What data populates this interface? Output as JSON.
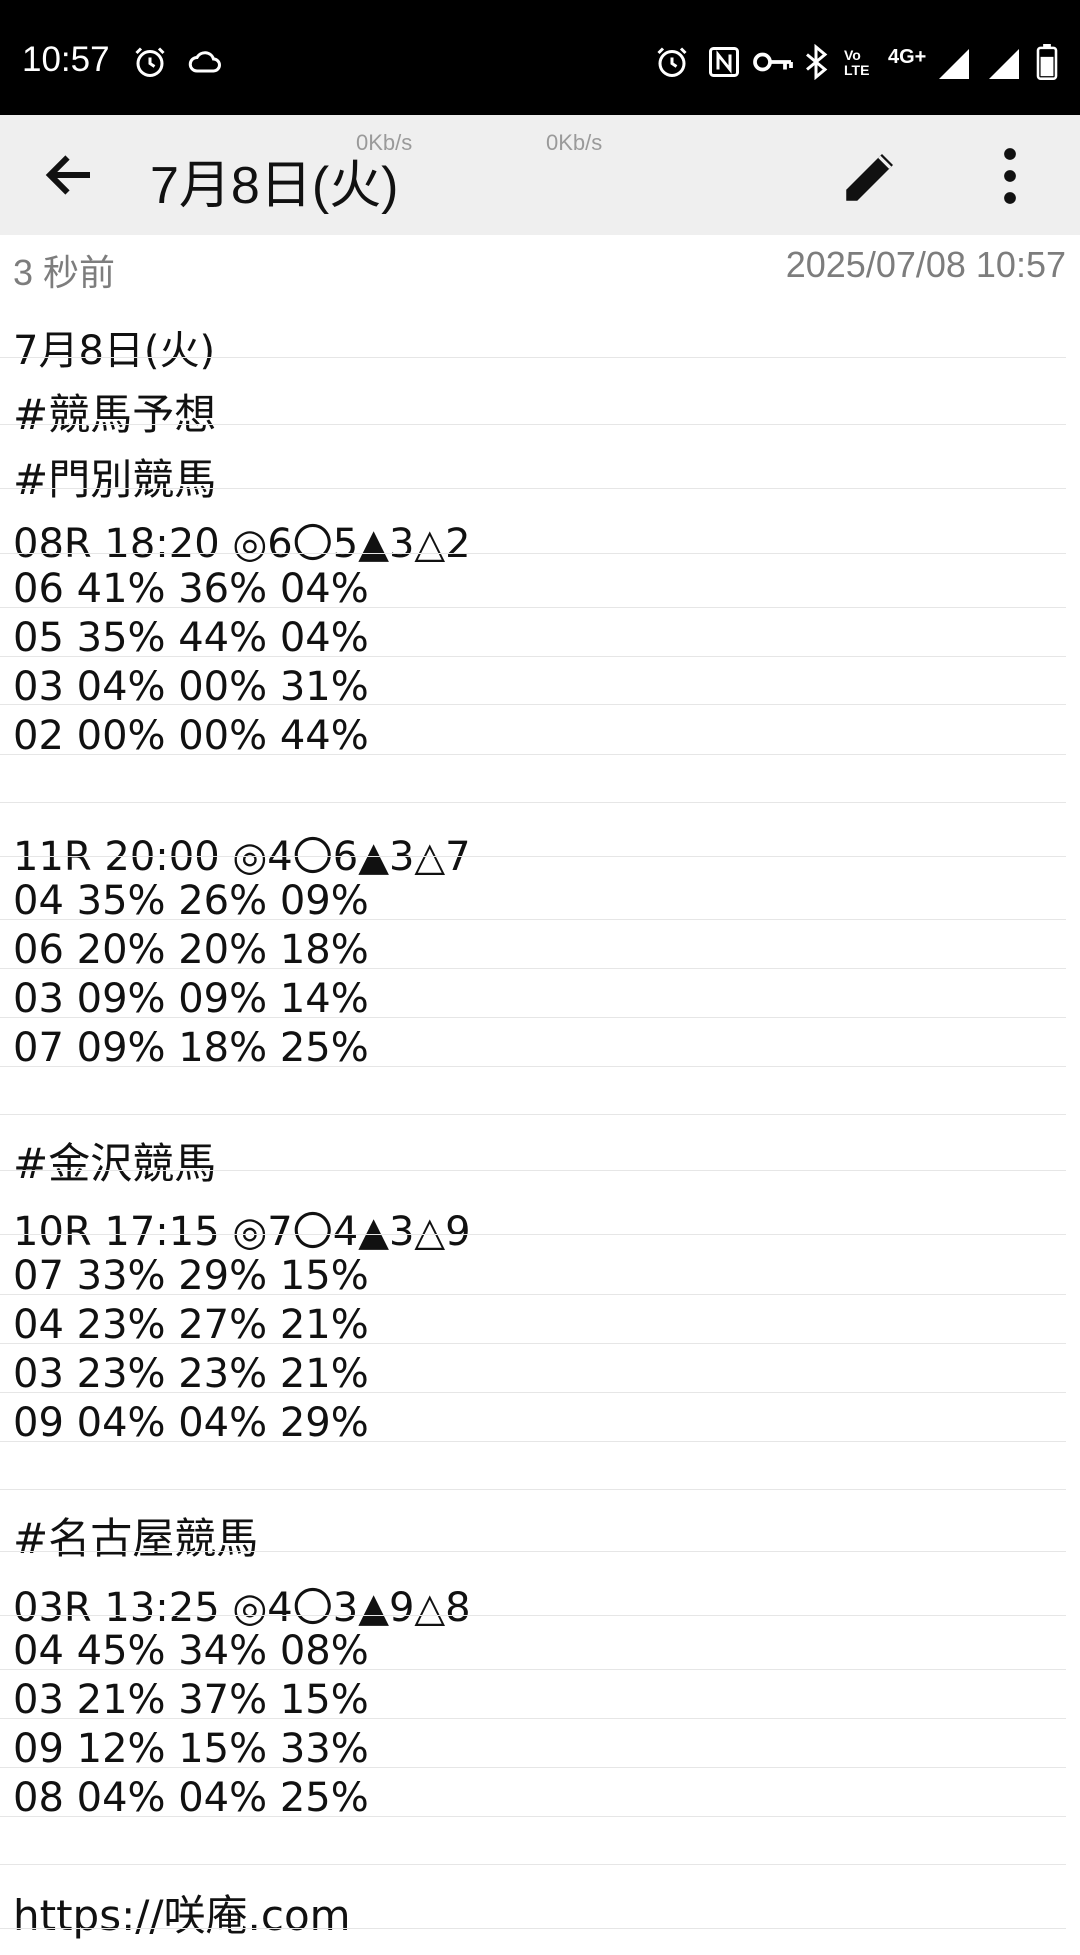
{
  "status_bar": {
    "time": "10:57",
    "left_icons": [
      "alarm-icon",
      "cloud-icon"
    ],
    "right_icons": [
      "alarm-icon",
      "nfc-icon",
      "vpn-key-icon",
      "bluetooth-icon",
      "volte-icon",
      "4g-plus-icon",
      "signal-icon",
      "signal-icon",
      "battery-icon"
    ],
    "network_label": "4G+",
    "volte_label": "Vo LTE"
  },
  "app_bar": {
    "title": "7月8日(火)",
    "net_speed_1": "0Kb/s",
    "net_speed_2": "0Kb/s"
  },
  "meta": {
    "relative_time": "3 秒前",
    "timestamp": "2025/07/08 10:57"
  },
  "note": {
    "lines": [
      "7月8日(火)",
      "#競馬予想",
      "#門別競馬",
      "08R 18:20 ◎6〇5▲3△2",
      "06 41% 36% 04%",
      "05 35% 44% 04%",
      "03 04% 00% 31%",
      "02 00% 00% 44%",
      "",
      "11R 20:00 ◎4〇6▲3△7",
      "04 35% 26% 09%",
      "06 20% 20% 18%",
      "03 09% 09% 14%",
      "07 09% 18% 25%",
      "",
      "#金沢競馬",
      "10R 17:15 ◎7〇4▲3△9",
      "07 33% 29% 15%",
      "04 23% 27% 21%",
      "03 23% 23% 21%",
      "09 04% 04% 29%",
      "",
      "#名古屋競馬",
      "03R 13:25 ◎4〇3▲9△8",
      "04 45% 34% 08%",
      "03 21% 37% 15%",
      "09 12% 15% 33%",
      "08 04% 04% 25%",
      "",
      "https://咲庵.com"
    ]
  }
}
